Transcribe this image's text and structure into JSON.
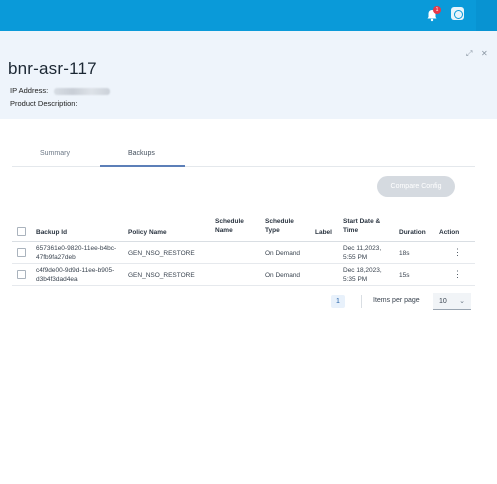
{
  "topbar": {
    "notification_count": "1",
    "icons": [
      "bell-icon",
      "app-launcher-icon"
    ]
  },
  "device": {
    "title": "bnr-asr-117",
    "ip_label": "IP Address:",
    "product_description_label": "Product Description:"
  },
  "window_controls": {
    "expand": "⤢",
    "close": "✕"
  },
  "tabs": [
    {
      "label": "Summary",
      "active": false
    },
    {
      "label": "Backups",
      "active": true
    }
  ],
  "actions": {
    "compare_config": "Compare Config"
  },
  "table": {
    "columns": [
      "Backup Id",
      "Policy Name",
      "Schedule Name",
      "Schedule Type",
      "Label",
      "Start Date & Time",
      "Duration",
      "Action"
    ],
    "rows": [
      {
        "backup_id": "657361e0-9820-11ee-b4bc-47fb9fa27deb",
        "policy_name": "GEN_NSO_RESTORE",
        "schedule_name": "",
        "schedule_type": "On Demand",
        "label": "",
        "start": "Dec 11,2023, 5:55 PM",
        "duration": "18s"
      },
      {
        "backup_id": "c4f9de00-9d9d-11ee-b905-d3b4f3dad4ea",
        "policy_name": "GEN_NSO_RESTORE",
        "schedule_name": "",
        "schedule_type": "On Demand",
        "label": "",
        "start": "Dec 18,2023, 5:35 PM",
        "duration": "15s"
      }
    ]
  },
  "pagination": {
    "current_page": "1",
    "items_per_page_label": "Items per page",
    "items_per_page_value": "10"
  },
  "colors": {
    "topbar": "#0a9ad9",
    "header_bg": "#eef4fb",
    "tab_underline": "#5c7fb8",
    "button_disabled": "#d5dae0",
    "badge": "#e5384a"
  }
}
